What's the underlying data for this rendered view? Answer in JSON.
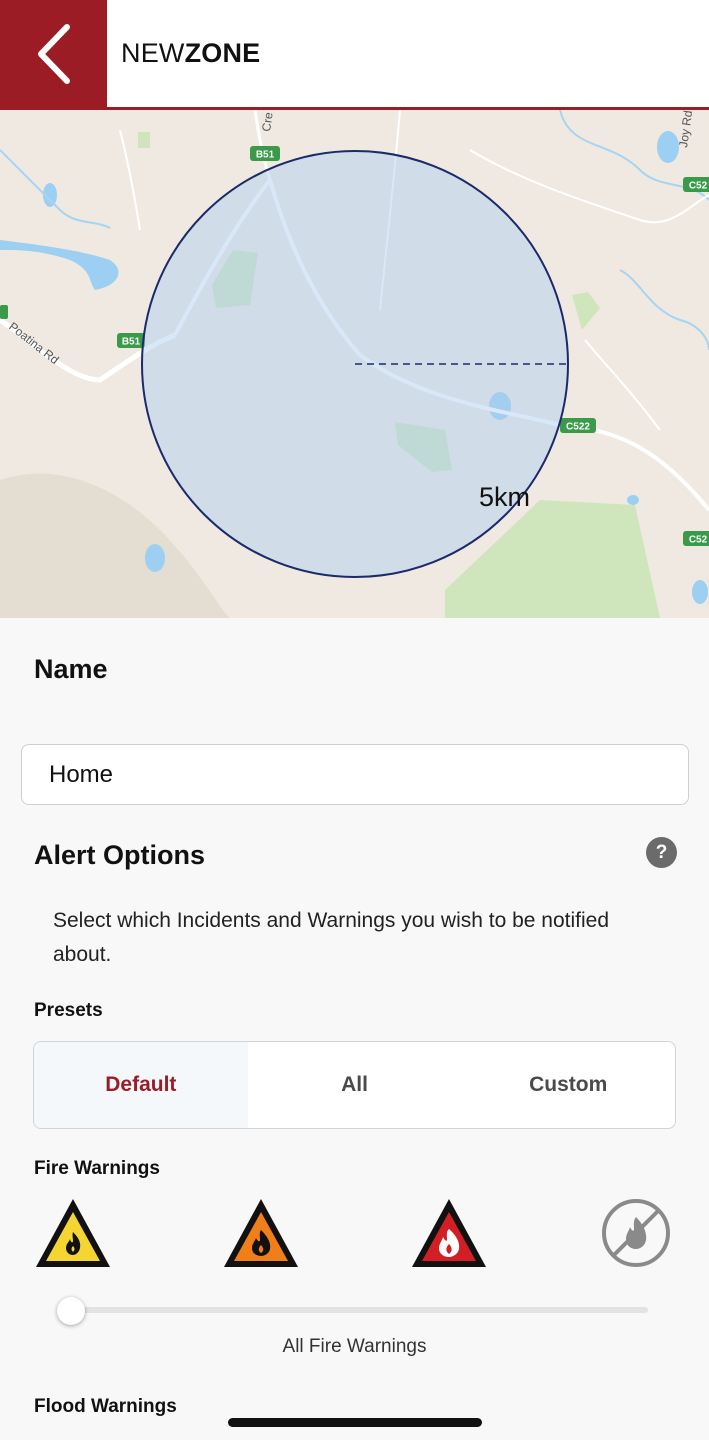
{
  "header": {
    "back_icon": "chevron-left-icon",
    "title_light": "NEW",
    "title_bold": "ZONE",
    "accent": "#9c1c25"
  },
  "map": {
    "radius_label": "5km",
    "road_labels": [
      "B51",
      "B51",
      "C522",
      "C52",
      "C52"
    ],
    "place_labels": [
      "Poatina Rd",
      "Cre",
      "Joy Rd"
    ]
  },
  "name_section": {
    "heading": "Name",
    "input_value": "Home"
  },
  "alert_options": {
    "heading": "Alert Options",
    "help_icon": "question-circle-icon",
    "help_label": "?",
    "description": "Select which Incidents and Warnings you wish to be notified about."
  },
  "presets": {
    "heading": "Presets",
    "options": [
      "Default",
      "All",
      "Custom"
    ],
    "selected": "Default"
  },
  "fire_warnings": {
    "heading": "Fire Warnings",
    "icons": [
      "fire-advice-icon",
      "fire-watch-and-act-icon",
      "fire-emergency-icon",
      "no-fire-warnings-icon"
    ],
    "colors": {
      "advice": "#f5d532",
      "watch_and_act": "#f07f1a",
      "emergency": "#d21f26"
    },
    "slider_value": 0,
    "slider_label": "All Fire Warnings"
  },
  "flood_warnings": {
    "heading": "Flood Warnings"
  }
}
